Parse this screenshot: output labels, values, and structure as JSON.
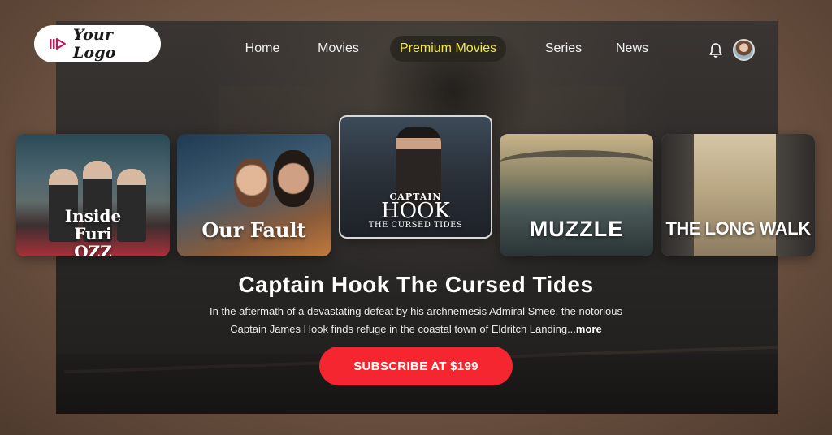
{
  "logo": {
    "text": "Your Logo",
    "icon": "play-logo-icon"
  },
  "nav": {
    "items": [
      {
        "label": "Home",
        "active": false
      },
      {
        "label": "Movies",
        "active": false
      },
      {
        "label": "Premium Movies",
        "active": true
      },
      {
        "label": "Series",
        "active": false
      },
      {
        "label": "News",
        "active": false
      }
    ],
    "icons": [
      "bell-icon",
      "user-avatar"
    ]
  },
  "carousel": {
    "cards": [
      {
        "title_line1": "Inside",
        "title_line2": "Furi",
        "title_line3": "OZZ"
      },
      {
        "title": "Our Fault"
      },
      {
        "title_top": "CAPTAIN",
        "title_main": "HOOK",
        "title_sub": "THE CURSED TIDES",
        "selected": true
      },
      {
        "title": "MUZZLE"
      },
      {
        "title": "THE LONG WALK"
      }
    ]
  },
  "hero": {
    "title": "Captain Hook The Cursed Tides",
    "description_line1": "In the aftermath of a devastating defeat by his archnemesis Admiral Smee, the notorious",
    "description_line2": "Captain James Hook finds refuge in the coastal town of Eldritch Landing...",
    "more_label": "more",
    "cta_label": "SUBSCRIBE AT $199"
  },
  "colors": {
    "accent": "#f5262f",
    "active_nav": "#f3ea3c",
    "text": "#ffffff"
  }
}
